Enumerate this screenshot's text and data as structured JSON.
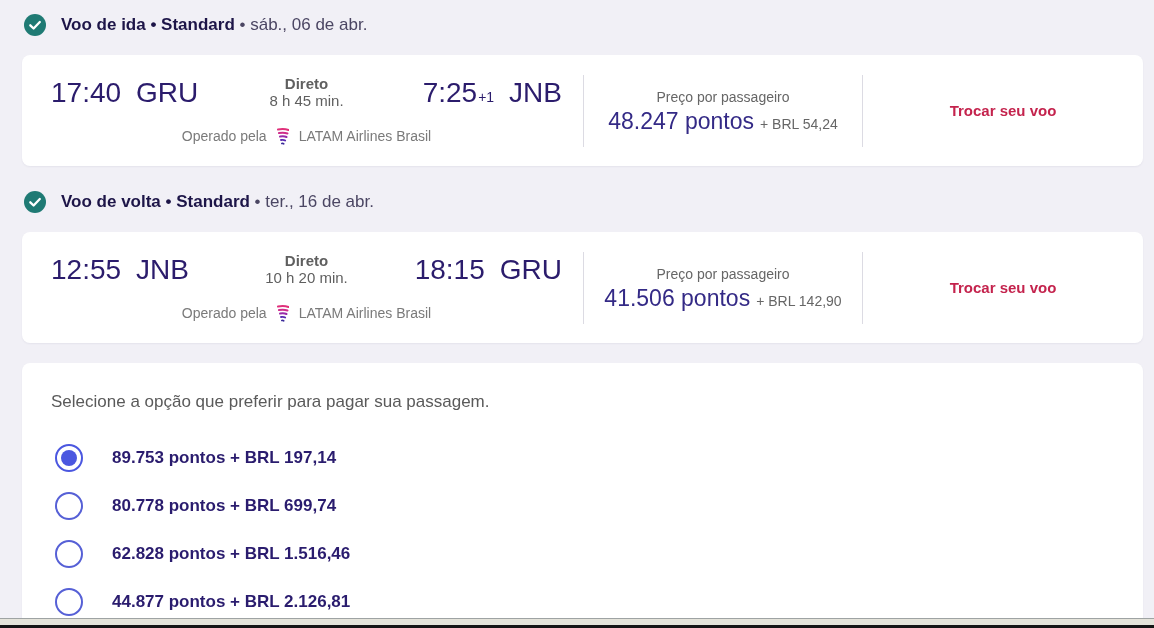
{
  "flights": [
    {
      "confirmed": true,
      "heading": "**Voo de ida • Standard** • sáb., 06 de abr.",
      "departure": {
        "time": "17:40",
        "airport": "GRU"
      },
      "stops": "Direto",
      "duration": "8 h 45 min.",
      "arrival": {
        "time": "7:25",
        "day_offset": "+1",
        "airport": "JNB"
      },
      "operated_by": "Operado pela",
      "airline": "LATAM Airlines Brasil",
      "price_label": "Preço por passageiro",
      "points": "48.247 pontos",
      "cash": "+ BRL 54,24",
      "change_link": "Trocar seu voo"
    },
    {
      "confirmed": true,
      "heading": "**Voo de volta • Standard** • ter., 16 de abr.",
      "departure": {
        "time": "12:55",
        "airport": "JNB"
      },
      "stops": "Direto",
      "duration": "10 h 20 min.",
      "arrival": {
        "time": "18:15",
        "airport": "GRU"
      },
      "operated_by": "Operado pela",
      "airline": "LATAM Airlines Brasil",
      "price_label": "Preço por passageiro",
      "points": "41.506 pontos",
      "cash": "+ BRL 142,90",
      "change_link": "Trocar seu voo"
    }
  ],
  "payment": {
    "instruction": "Selecione a opção que preferir para pagar sua passagem.",
    "options": [
      {
        "label": "89.753 pontos + BRL 197,14",
        "selected": true
      },
      {
        "label": "80.778 pontos + BRL 699,74",
        "selected": false
      },
      {
        "label": "62.828 pontos + BRL 1.516,46",
        "selected": false
      },
      {
        "label": "44.877 pontos + BRL 2.126,81",
        "selected": false
      }
    ]
  }
}
